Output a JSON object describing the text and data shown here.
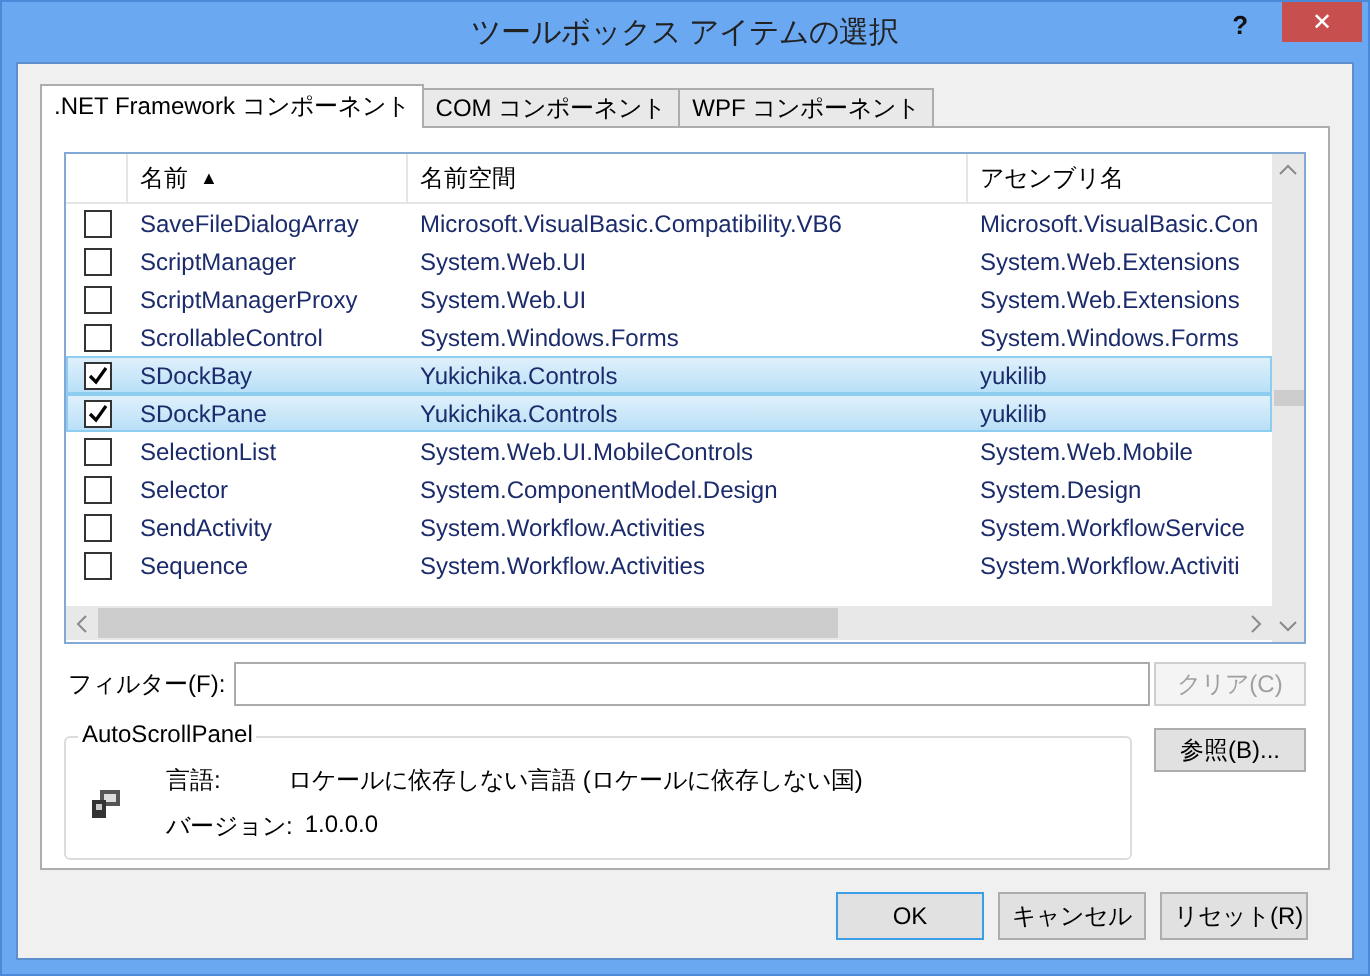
{
  "window": {
    "title": "ツールボックス アイテムの選択",
    "help": "?",
    "close": "✕"
  },
  "tabs": [
    {
      "label": ".NET Framework コンポーネント",
      "selected": true
    },
    {
      "label": "COM コンポーネント",
      "selected": false
    },
    {
      "label": "WPF コンポーネント",
      "selected": false
    }
  ],
  "table": {
    "columns": [
      {
        "label": "名前",
        "sort": "▲"
      },
      {
        "label": "名前空間"
      },
      {
        "label": "アセンブリ名"
      }
    ],
    "rows": [
      {
        "checked": false,
        "selected": false,
        "cells": [
          "SaveFileDialogArray",
          "Microsoft.VisualBasic.Compatibility.VB6",
          "Microsoft.VisualBasic.Con"
        ]
      },
      {
        "checked": false,
        "selected": false,
        "cells": [
          "ScriptManager",
          "System.Web.UI",
          "System.Web.Extensions"
        ]
      },
      {
        "checked": false,
        "selected": false,
        "cells": [
          "ScriptManagerProxy",
          "System.Web.UI",
          "System.Web.Extensions"
        ]
      },
      {
        "checked": false,
        "selected": false,
        "cells": [
          "ScrollableControl",
          "System.Windows.Forms",
          "System.Windows.Forms"
        ]
      },
      {
        "checked": true,
        "selected": true,
        "cells": [
          "SDockBay",
          "Yukichika.Controls",
          "yukilib"
        ]
      },
      {
        "checked": true,
        "selected": true,
        "cells": [
          "SDockPane",
          "Yukichika.Controls",
          "yukilib"
        ]
      },
      {
        "checked": false,
        "selected": false,
        "cells": [
          "SelectionList",
          "System.Web.UI.MobileControls",
          "System.Web.Mobile"
        ]
      },
      {
        "checked": false,
        "selected": false,
        "cells": [
          "Selector",
          "System.ComponentModel.Design",
          "System.Design"
        ]
      },
      {
        "checked": false,
        "selected": false,
        "cells": [
          "SendActivity",
          "System.Workflow.Activities",
          "System.WorkflowService"
        ]
      },
      {
        "checked": false,
        "selected": false,
        "cells": [
          "Sequence",
          "System.Workflow.Activities",
          "System.Workflow.Activiti"
        ]
      }
    ]
  },
  "filter": {
    "label": "フィルター(F):",
    "clear_button": "クリア(C)",
    "clear_disabled": true
  },
  "details": {
    "title": "AutoScrollPanel",
    "fields": [
      {
        "label": "言語:",
        "value": "ロケールに依存しない言語 (ロケールに依存しない国)"
      },
      {
        "label": "バージョン:",
        "value": "1.0.0.0"
      }
    ]
  },
  "browse_button": "参照(B)...",
  "buttons": [
    {
      "label": "OK",
      "default": true
    },
    {
      "label": "キャンセル",
      "default": false
    },
    {
      "label": "リセット(R)",
      "default": false
    }
  ]
}
